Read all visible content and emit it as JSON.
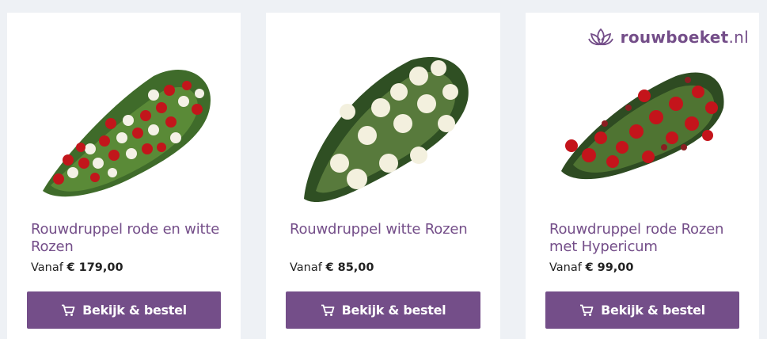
{
  "brand": {
    "name": "rouwboeket",
    "tld": ".nl",
    "color": "#744e89"
  },
  "products": [
    {
      "title": "Rouwdruppel rode en witte Rozen",
      "price_prefix": "Vanaf",
      "price": "€ 179,00",
      "button_label": "Bekijk & bestel",
      "image": "red-and-white-roses-teardrop-arrangement"
    },
    {
      "title": "Rouwdruppel witte Rozen",
      "price_prefix": "Vanaf",
      "price": "€ 85,00",
      "button_label": "Bekijk & bestel",
      "image": "white-roses-teardrop-arrangement"
    },
    {
      "title": "Rouwdruppel rode Rozen met Hypericum",
      "price_prefix": "Vanaf",
      "price": "€ 99,00",
      "button_label": "Bekijk & bestel",
      "image": "red-roses-hypericum-teardrop-arrangement"
    }
  ],
  "icons": {
    "button_icon": "cart-icon",
    "logo_icon": "lotus-icon"
  }
}
